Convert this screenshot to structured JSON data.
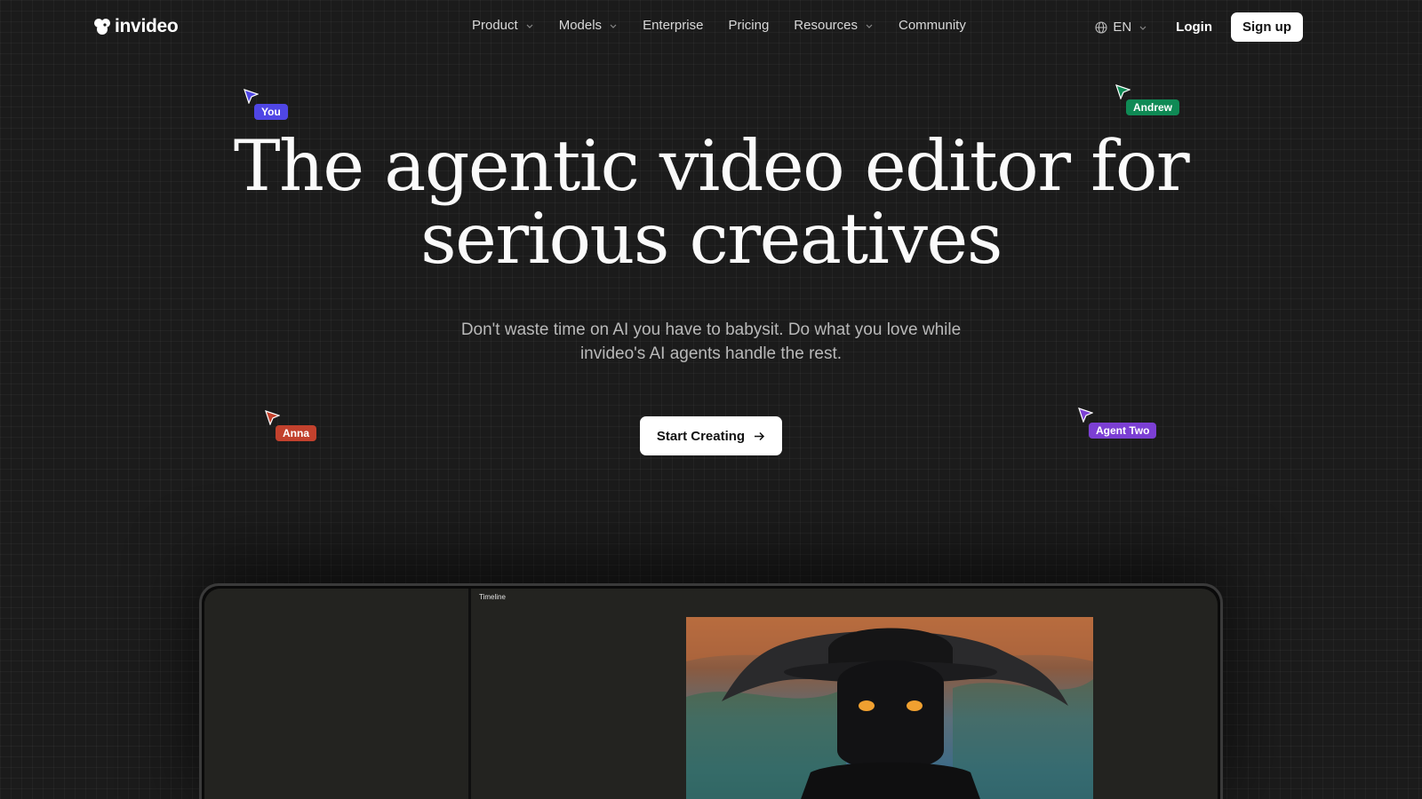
{
  "brand": {
    "name": "invideo"
  },
  "nav": {
    "items": [
      {
        "label": "Product",
        "has_dropdown": true
      },
      {
        "label": "Models",
        "has_dropdown": true
      },
      {
        "label": "Enterprise",
        "has_dropdown": false
      },
      {
        "label": "Pricing",
        "has_dropdown": false
      },
      {
        "label": "Resources",
        "has_dropdown": true
      },
      {
        "label": "Community",
        "has_dropdown": false
      }
    ],
    "language": "EN",
    "login_label": "Login",
    "signup_label": "Sign up"
  },
  "hero": {
    "title_line1": "The agentic video editor for",
    "title_line2": "serious creatives",
    "subtitle": "Don't waste time on AI you have to babysit. Do what you love while invideo's AI agents handle the rest.",
    "cta_label": "Start Creating"
  },
  "cursors": [
    {
      "name": "You",
      "color": "#4f46e5"
    },
    {
      "name": "Andrew",
      "color": "#0f8a55"
    },
    {
      "name": "Anna",
      "color": "#c2412d"
    },
    {
      "name": "Agent Two",
      "color": "#7c3fd4"
    }
  ],
  "preview": {
    "timeline_label": "Timeline"
  },
  "colors": {
    "background": "#1b1b1b",
    "button_bg": "#ffffff"
  }
}
